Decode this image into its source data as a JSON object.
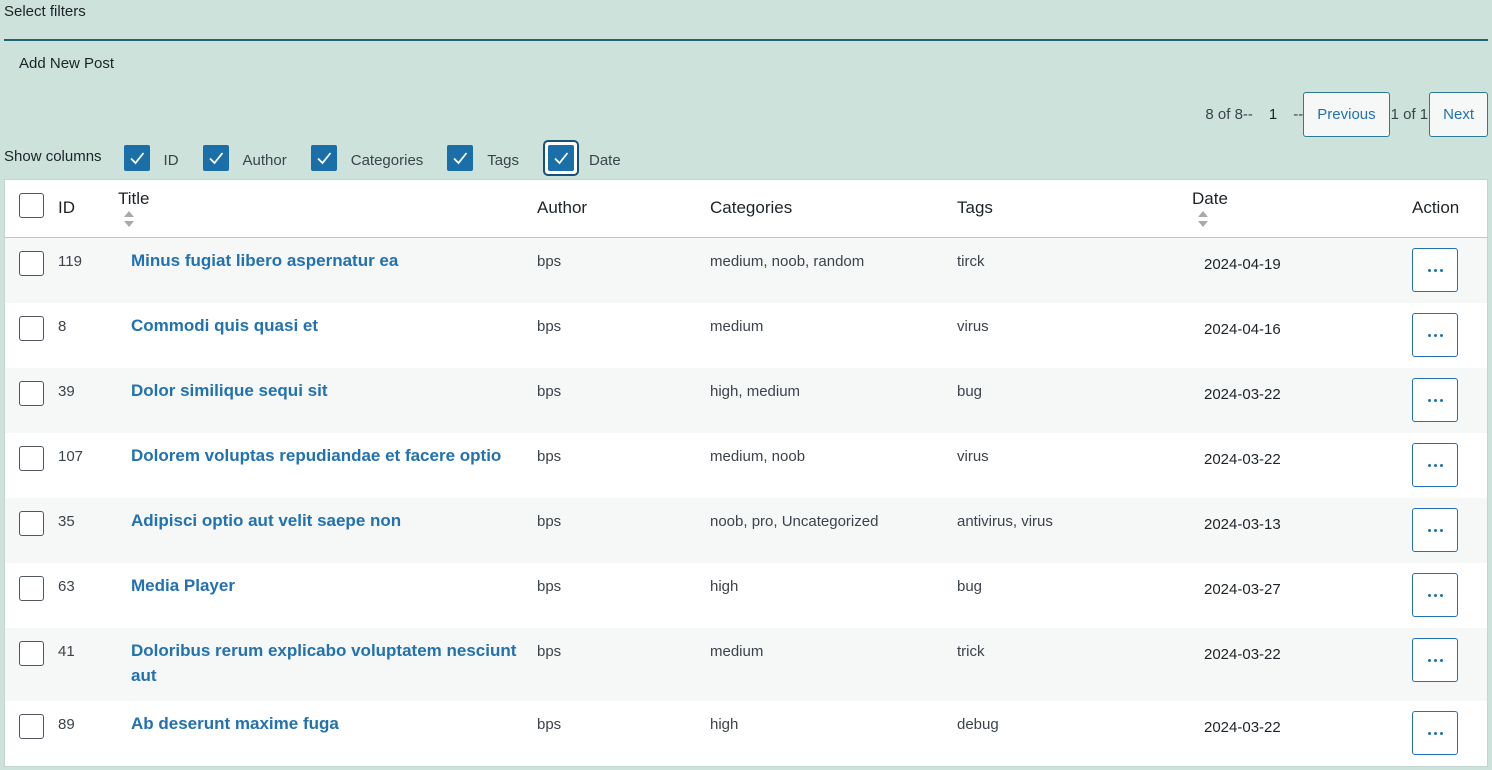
{
  "filters": {
    "title": "Select filters"
  },
  "actions": {
    "add_new_post": "Add New Post"
  },
  "pagination": {
    "count": "8 of 8--",
    "page": "1",
    "sep": "--",
    "previous": "Previous",
    "of": "1 of 1",
    "next": "Next"
  },
  "show_columns": {
    "label": "Show columns",
    "options": [
      {
        "label": "ID",
        "checked": true
      },
      {
        "label": "Author",
        "checked": true
      },
      {
        "label": "Categories",
        "checked": true
      },
      {
        "label": "Tags",
        "checked": true
      },
      {
        "label": "Date",
        "checked": true
      }
    ]
  },
  "table": {
    "headers": {
      "id": "ID",
      "title": "Title",
      "author": "Author",
      "categories": "Categories",
      "tags": "Tags",
      "date": "Date",
      "action": "Action"
    },
    "rows": [
      {
        "id": "119",
        "title": "Minus fugiat libero aspernatur ea",
        "author": "bps",
        "categories": "medium, noob, random",
        "tags": "tirck",
        "date": "2024-04-19"
      },
      {
        "id": "8",
        "title": "Commodi quis quasi et",
        "author": "bps",
        "categories": "medium",
        "tags": "virus",
        "date": "2024-04-16"
      },
      {
        "id": "39",
        "title": "Dolor similique sequi sit",
        "author": "bps",
        "categories": "high, medium",
        "tags": "bug",
        "date": "2024-03-22"
      },
      {
        "id": "107",
        "title": "Dolorem voluptas repudiandae et facere optio",
        "author": "bps",
        "categories": "medium, noob",
        "tags": "virus",
        "date": "2024-03-22"
      },
      {
        "id": "35",
        "title": "Adipisci optio aut velit saepe non",
        "author": "bps",
        "categories": "noob, pro, Uncategorized",
        "tags": "antivirus, virus",
        "date": "2024-03-13"
      },
      {
        "id": "63",
        "title": "Media Player",
        "author": "bps",
        "categories": "high",
        "tags": "bug",
        "date": "2024-03-27"
      },
      {
        "id": "41",
        "title": "Doloribus rerum explicabo voluptatem nesciunt aut",
        "author": "bps",
        "categories": "medium",
        "tags": "trick",
        "date": "2024-03-22"
      },
      {
        "id": "89",
        "title": "Ab deserunt maxime fuga",
        "author": "bps",
        "categories": "high",
        "tags": "debug",
        "date": "2024-03-22"
      }
    ]
  },
  "colors": {
    "background": "#cde2db",
    "link": "#2271b1",
    "checkbox": "#1a6fa8",
    "header_rule": "#1e6472"
  }
}
